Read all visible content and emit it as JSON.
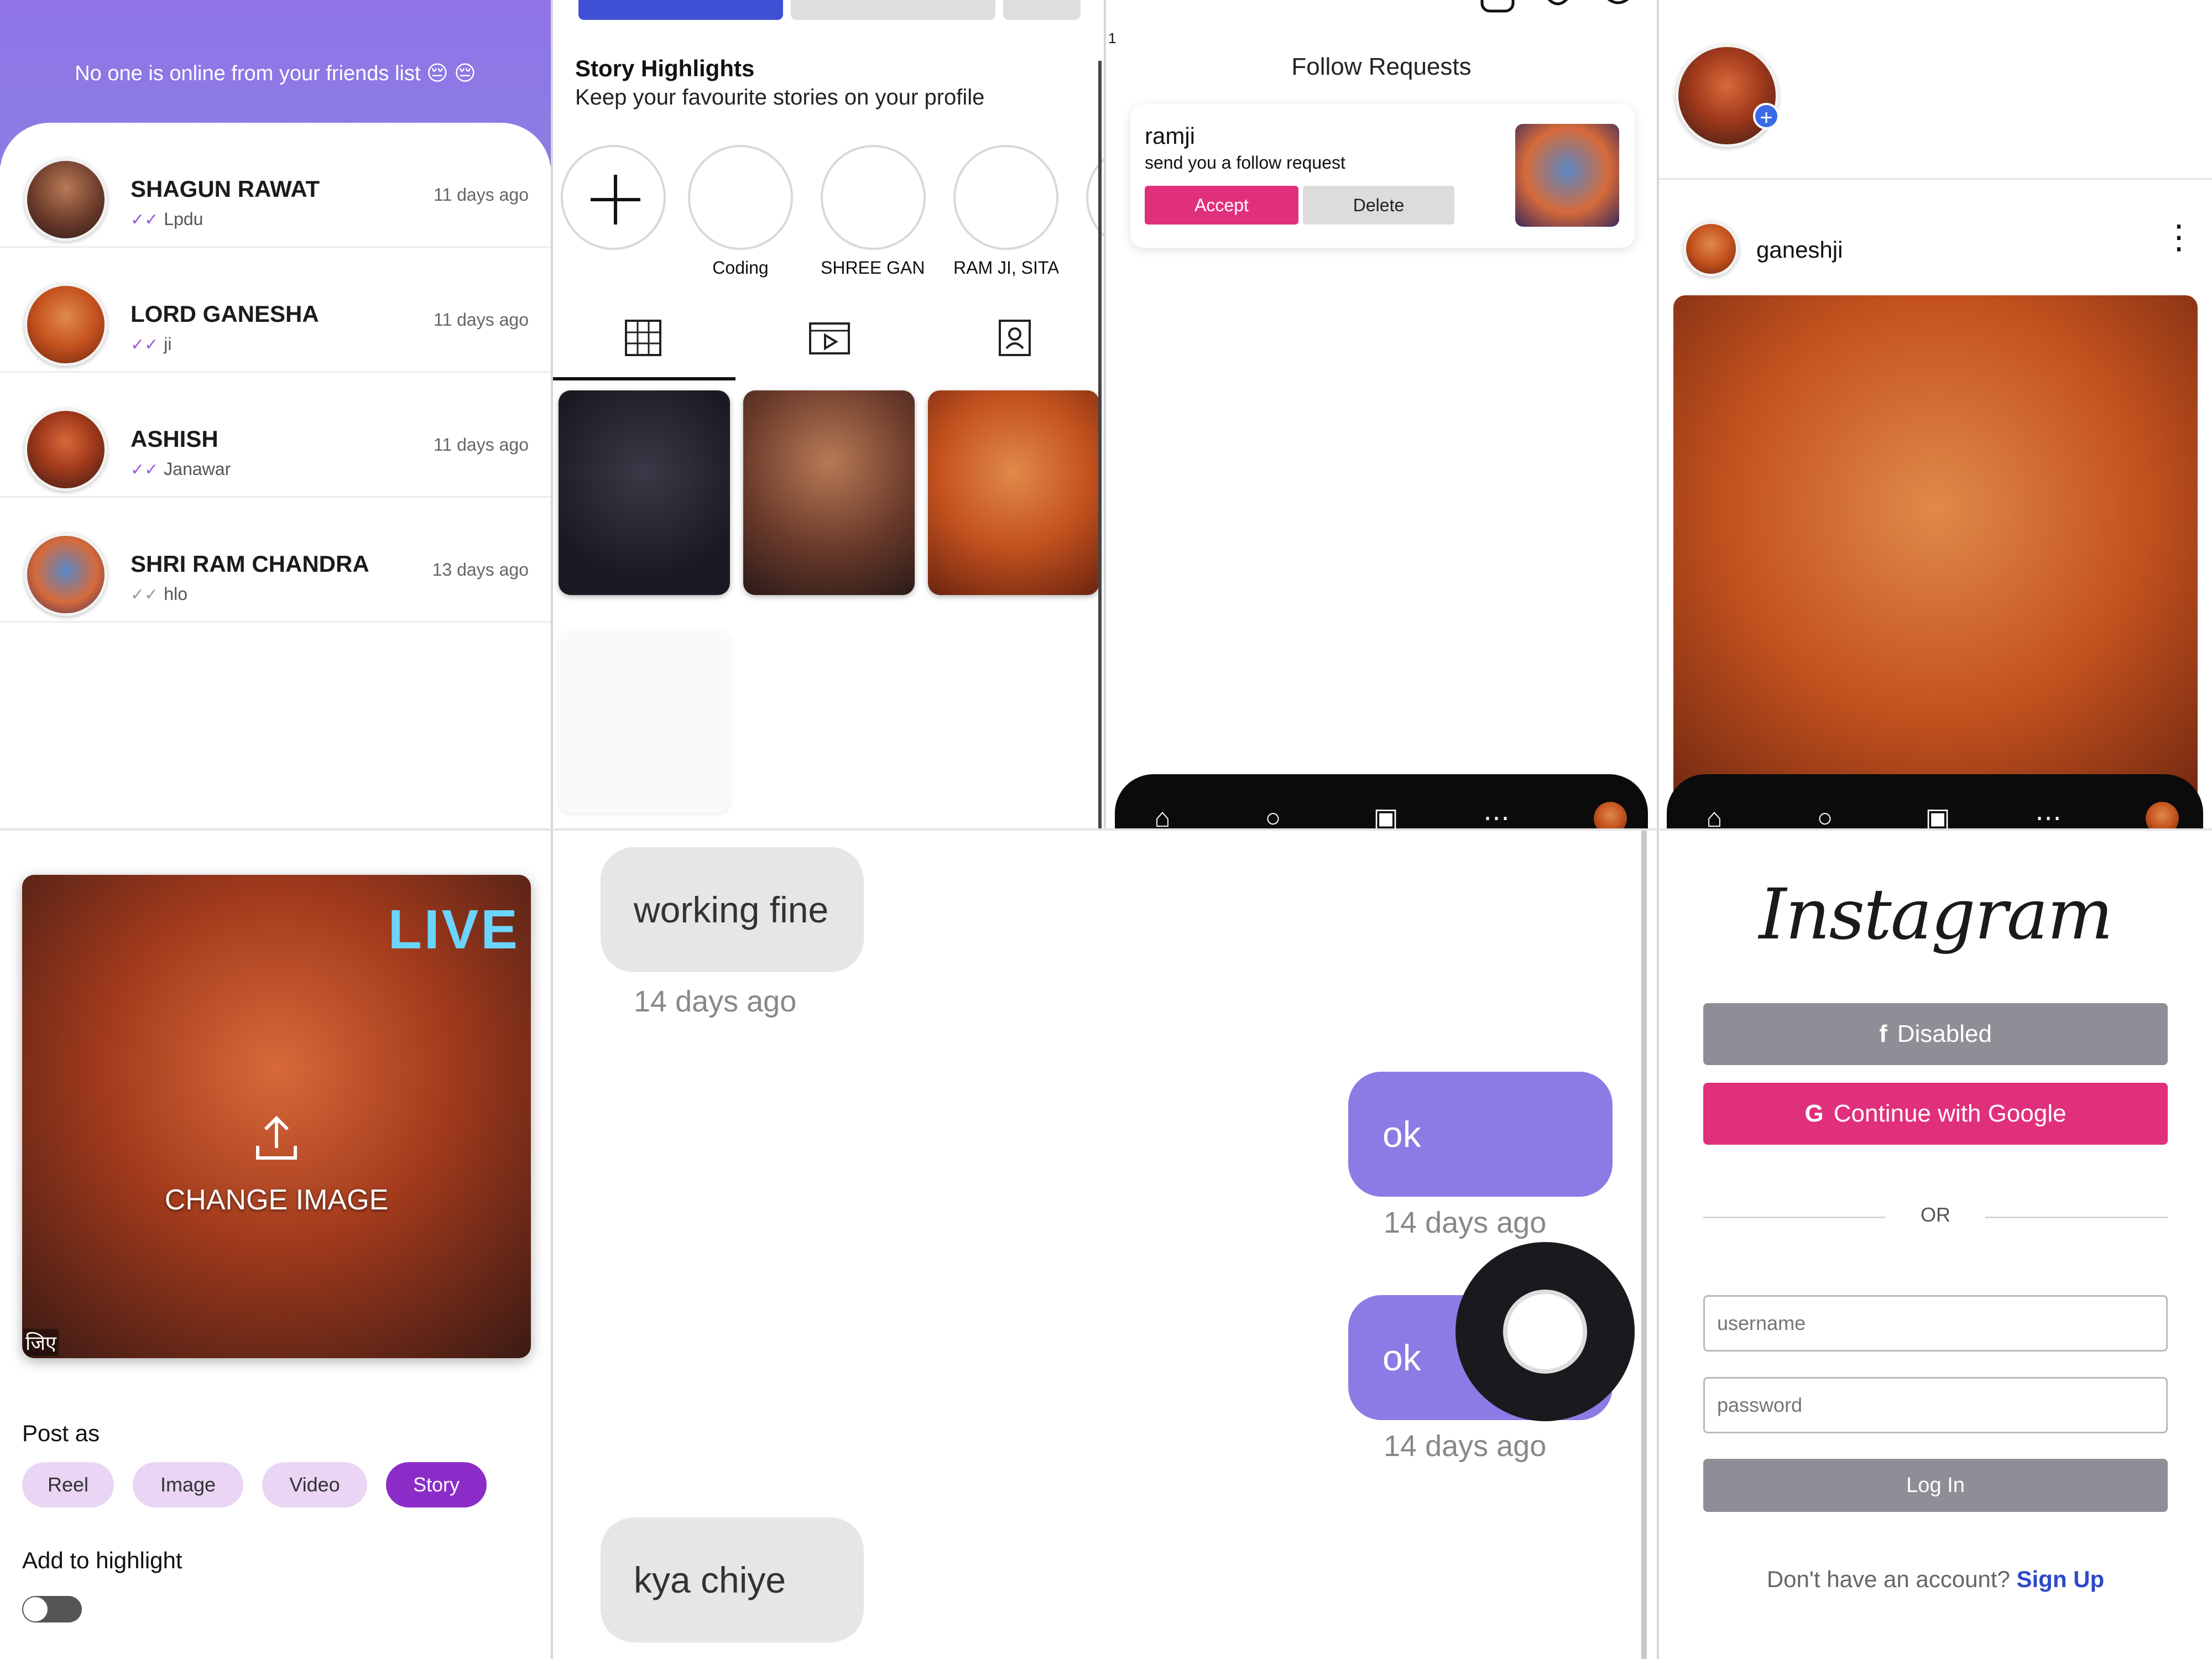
{
  "chats": {
    "banner": "No one is online from your friends list 😔 😔",
    "rows": [
      {
        "name": "SHAGUN RAWAT",
        "last": "Lpdu",
        "time": "11 days ago"
      },
      {
        "name": "LORD GANESHA",
        "last": "ji",
        "time": "11 days ago"
      },
      {
        "name": "ASHISH",
        "last": "Janawar",
        "time": "11 days ago"
      },
      {
        "name": "SHRI RAM CHANDRA",
        "last": "hlo",
        "time": "13 days ago"
      }
    ]
  },
  "profile": {
    "highlights_title": "Story Highlights",
    "highlights_sub": "Keep your favourite stories on your profile",
    "highlights": [
      "Coding",
      "SHREE GANESH",
      "RAM JI, SITA M"
    ]
  },
  "requests": {
    "title": "Follow Requests",
    "username": "ramji",
    "text": "send you a follow request",
    "accept": "Accept",
    "delete": "Delete",
    "corner": "1"
  },
  "feed": {
    "post_user": "ganeshji",
    "plus": "+"
  },
  "create": {
    "change_image": "CHANGE IMAGE",
    "live": "LIVE",
    "hindi": "जिए",
    "post_as": "Post as",
    "types": [
      "Reel",
      "Image",
      "Video",
      "Story"
    ],
    "add_highlight": "Add to highlight"
  },
  "conversation": {
    "messages": [
      {
        "dir": "in",
        "text": "working fine",
        "time": "14 days ago"
      },
      {
        "dir": "out",
        "text": "ok",
        "time": "14 days ago"
      },
      {
        "dir": "out",
        "text": "ok",
        "time": "14 days ago"
      },
      {
        "dir": "in",
        "text": "kya chiye",
        "time": ""
      }
    ]
  },
  "login": {
    "logo": "Instagram",
    "fb_button": "Disabled",
    "google_button": "Continue with Google",
    "or": "OR",
    "username_placeholder": "username",
    "password_placeholder": "password",
    "login_button": "Log In",
    "no_account": "Don't have an account?",
    "signup": "Sign Up"
  },
  "colors": {
    "accent_purple": "#8c7be4",
    "pink": "#e0307c",
    "chip_selected": "#8c2cc8"
  }
}
